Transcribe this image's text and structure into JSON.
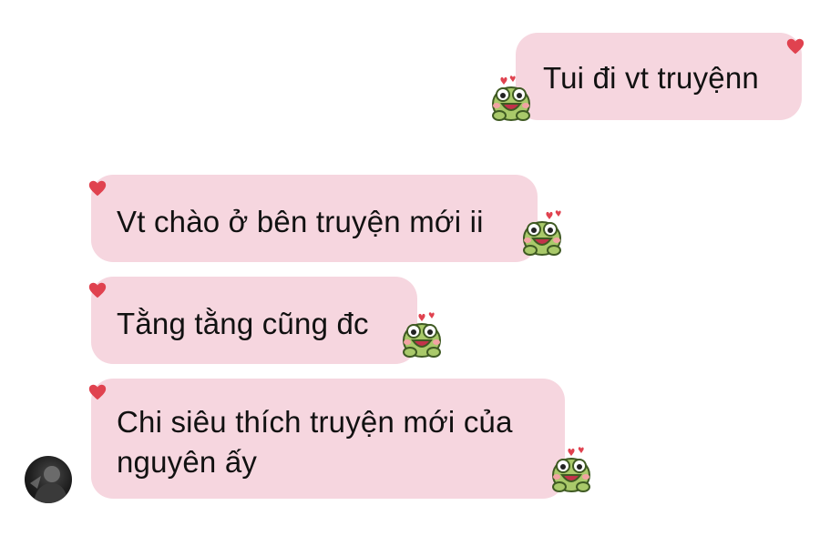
{
  "conversation": {
    "messages": [
      {
        "sender": "me",
        "text": "Tui đi vt truyệnn"
      },
      {
        "sender": "other",
        "text": "Vt chào ở bên truyện mới ii"
      },
      {
        "sender": "other",
        "text": "Tằng tằng cũng đc"
      },
      {
        "sender": "other",
        "text": "Chi siêu thích truyện mới của\nnguyên ấy"
      }
    ]
  },
  "reaction": {
    "icon": "heart-icon",
    "color": "#e0424f"
  },
  "sticker": {
    "icon": "frog-sticker-icon",
    "color": "#a9c96a"
  },
  "colors": {
    "bubble": "#f6d6df",
    "text": "#111111"
  }
}
